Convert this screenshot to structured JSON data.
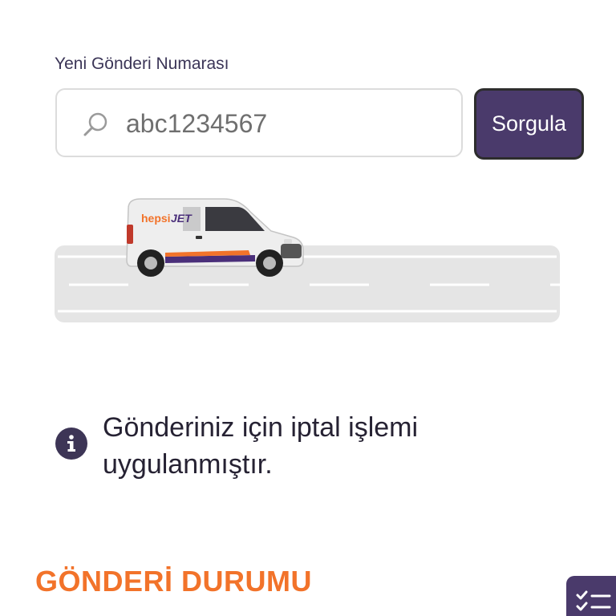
{
  "tracking_form": {
    "label": "Yeni Gönderi Numarası",
    "input_value": "abc1234567",
    "button_label": "Sorgula"
  },
  "illustration": {
    "brand_prefix": "hepsi",
    "brand_suffix": "JET"
  },
  "notice": {
    "icon": "info-icon",
    "text": "Gönderiniz için iptal işlemi uygulanmıştır."
  },
  "status_section": {
    "title": "GÖNDERİ DURUMU",
    "action_icon": "checklist-icon"
  },
  "colors": {
    "primary": "#4a3a6b",
    "accent_orange": "#f2732a",
    "road": "#e5e5e5",
    "text_dark": "#262233"
  }
}
